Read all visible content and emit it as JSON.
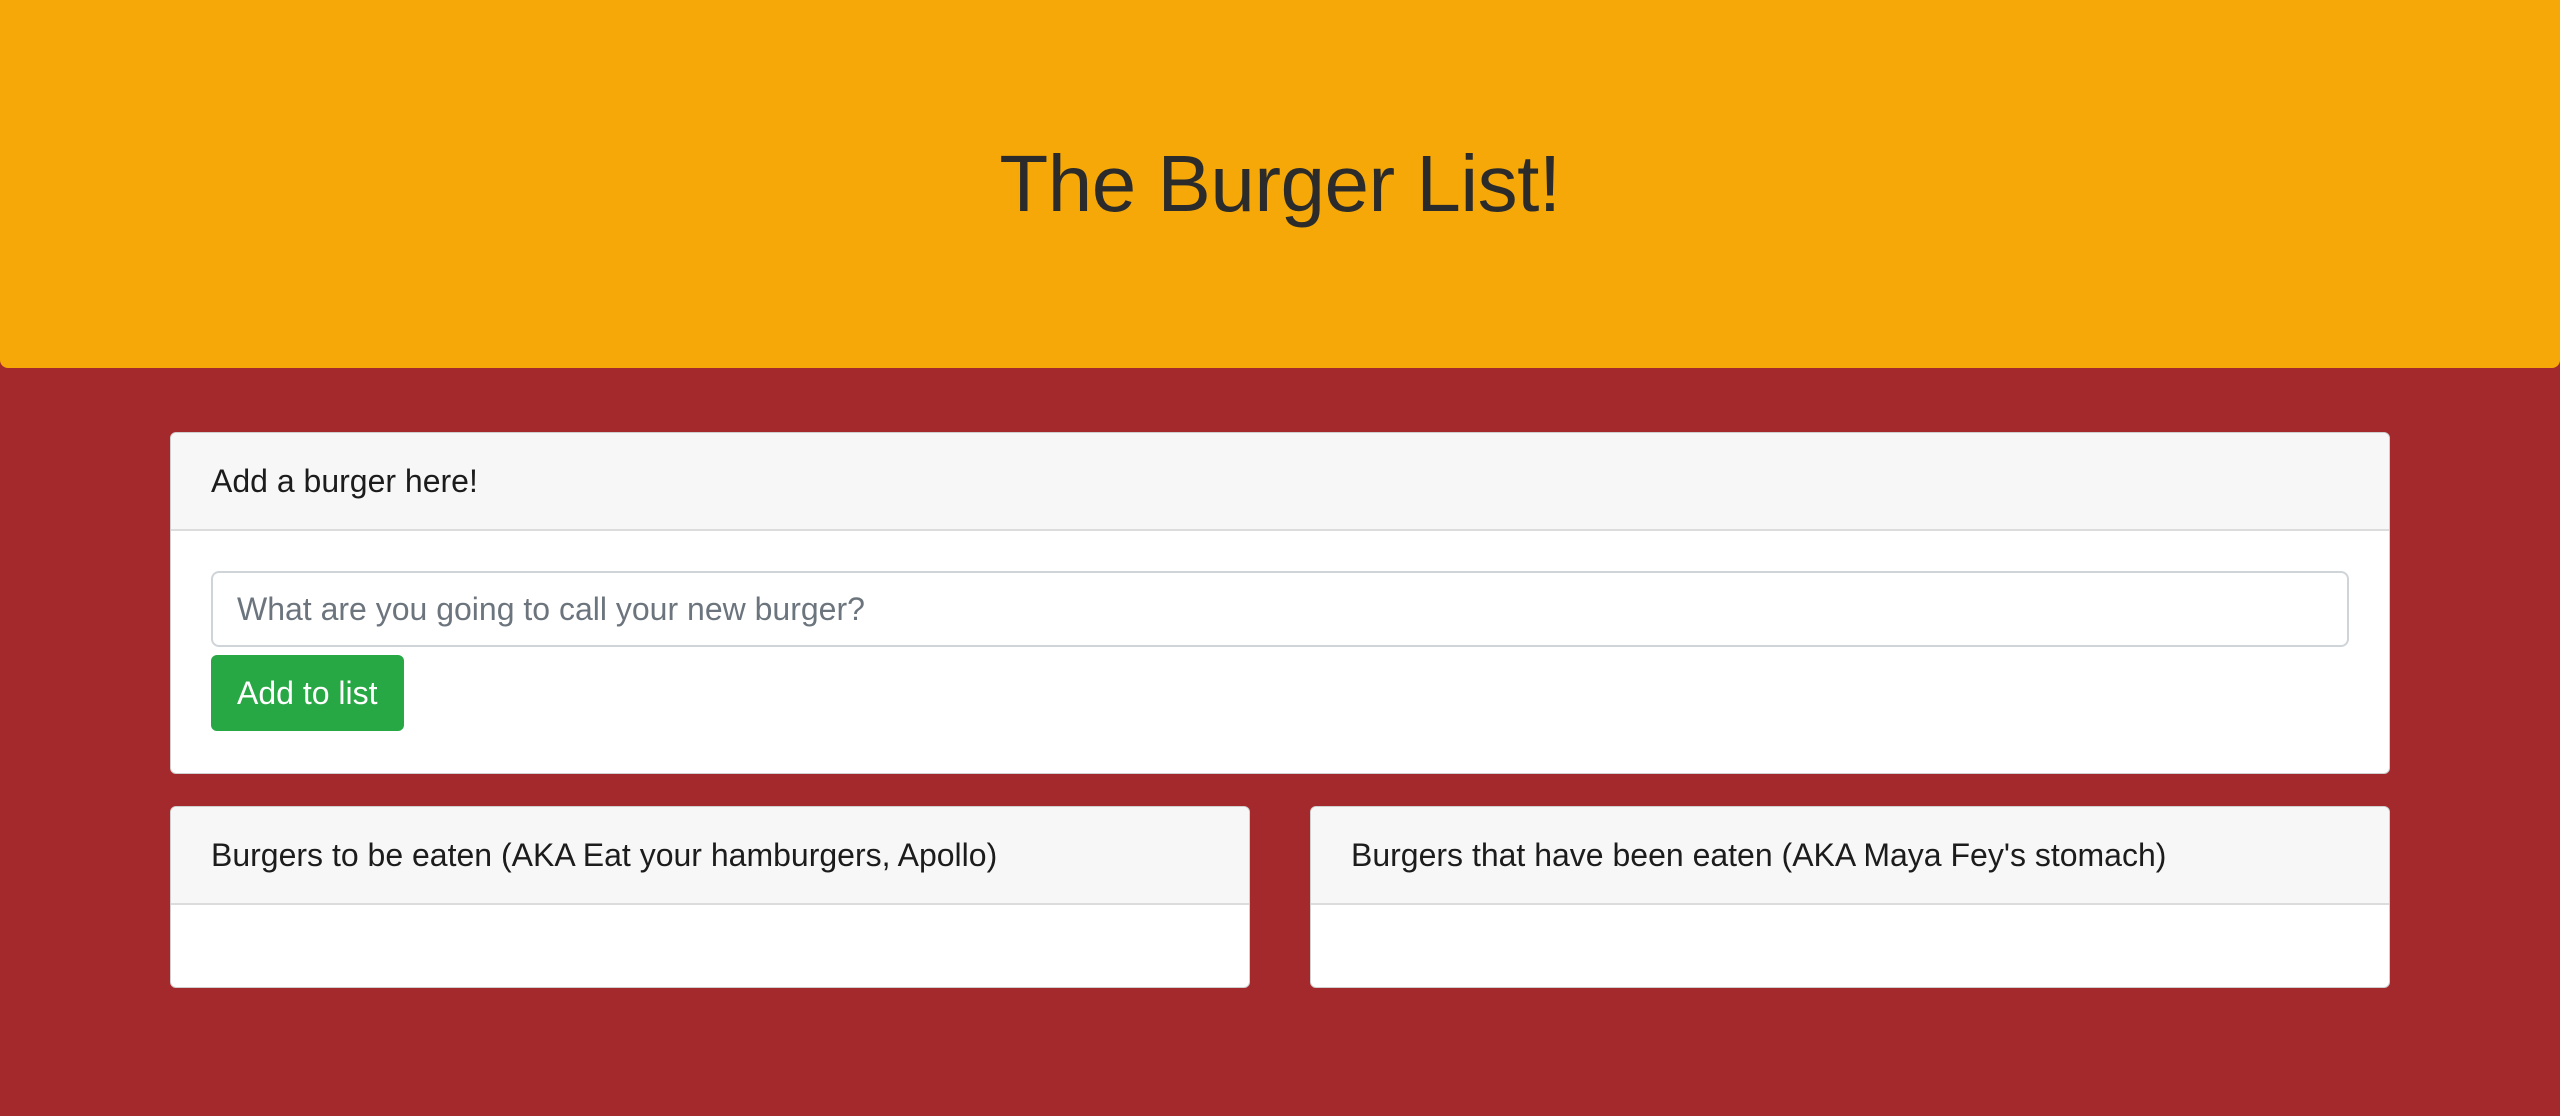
{
  "header": {
    "title": "The Burger List!"
  },
  "add_form": {
    "title": "Add a burger here!",
    "input_value": "",
    "input_placeholder": "What are you going to call your new burger?",
    "button_label": "Add to list"
  },
  "lists": {
    "uneaten": {
      "title": "Burgers to be eaten (AKA Eat your hamburgers, Apollo)",
      "items": []
    },
    "eaten": {
      "title": "Burgers that have been eaten (AKA Maya Fey's stomach)",
      "items": []
    }
  },
  "colors": {
    "page_background": "#a4292c",
    "header_background": "#f5a807",
    "button_background": "#28a745"
  }
}
